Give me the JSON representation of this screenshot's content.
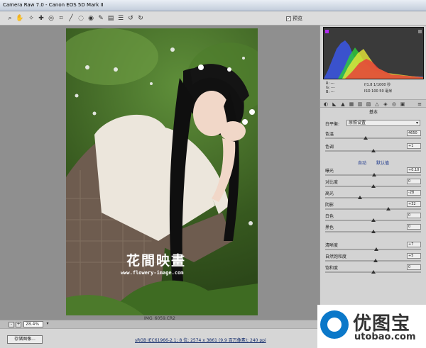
{
  "window": {
    "title": "Camera Raw 7.0 -  Canon EOS 5D Mark II"
  },
  "toolbar": {
    "tools": [
      {
        "name": "zoom-tool",
        "glyph": "⌕"
      },
      {
        "name": "hand-tool",
        "glyph": "✋"
      },
      {
        "name": "white-balance-tool",
        "glyph": "✧"
      },
      {
        "name": "color-sampler-tool",
        "glyph": "✚"
      },
      {
        "name": "targeted-adjustment-tool",
        "glyph": "◎"
      },
      {
        "name": "crop-tool",
        "glyph": "⌗"
      },
      {
        "name": "straighten-tool",
        "glyph": "╱"
      },
      {
        "name": "spot-removal-tool",
        "glyph": "◌"
      },
      {
        "name": "red-eye-tool",
        "glyph": "◉"
      },
      {
        "name": "adjustment-brush-tool",
        "glyph": "✎"
      },
      {
        "name": "graduated-filter-tool",
        "glyph": "▤"
      },
      {
        "name": "preferences",
        "glyph": "☰"
      },
      {
        "name": "rotate-left",
        "glyph": "↺"
      },
      {
        "name": "rotate-right",
        "glyph": "↻"
      }
    ],
    "preview_label": "预览",
    "preview_checked": "✓"
  },
  "photo": {
    "watermark_title": "花間映畫",
    "watermark_url": "www.flowery-image.com",
    "filename": "IMG_6059.CR2"
  },
  "zoom": {
    "minus": "-",
    "plus": "+",
    "value": "28.4%",
    "dropdown": "▾"
  },
  "bottom": {
    "save_label": "存储图像...",
    "workflow_text": "sRGB IEC61966-2.1; 8 位; 2574 x 3861 (9.9 百万像素); 240 ppi"
  },
  "readout": {
    "r": "R:  ---",
    "g": "G:  ---",
    "b": "B:  ---",
    "aperture_shutter": "f/1.8   1/1000 秒",
    "iso_focal": "ISO 100   50 毫米"
  },
  "panel": {
    "section_title": "基本",
    "tab_icons": [
      "◐",
      "◣",
      "▲",
      "▦",
      "▥",
      "▧",
      "△",
      "◈",
      "◎",
      "▣",
      "≡"
    ],
    "white_balance": {
      "label": "白平衡:",
      "value": "原照设置"
    },
    "temp": {
      "label": "色温",
      "value": "4650",
      "level": 0.42
    },
    "tint": {
      "label": "色调",
      "value": "+1",
      "level": 0.5
    },
    "auto_label": "自动",
    "default_label": "默认值",
    "exposure": {
      "label": "曝光",
      "value": "+0.10",
      "level": 0.51
    },
    "contrast": {
      "label": "对比度",
      "value": "0",
      "level": 0.5
    },
    "highlights": {
      "label": "高光",
      "value": "-28",
      "level": 0.36
    },
    "shadows": {
      "label": "阴影",
      "value": "+32",
      "level": 0.66
    },
    "whites": {
      "label": "白色",
      "value": "0",
      "level": 0.5
    },
    "blacks": {
      "label": "黑色",
      "value": "0",
      "level": 0.5
    },
    "clarity": {
      "label": "清晰度",
      "value": "+7",
      "level": 0.535
    },
    "vibrance": {
      "label": "自然饱和度",
      "value": "+5",
      "level": 0.525
    },
    "saturation": {
      "label": "饱和度",
      "value": "0",
      "level": 0.5
    }
  },
  "logo": {
    "name": "优图宝",
    "domain": "utobao.com"
  }
}
